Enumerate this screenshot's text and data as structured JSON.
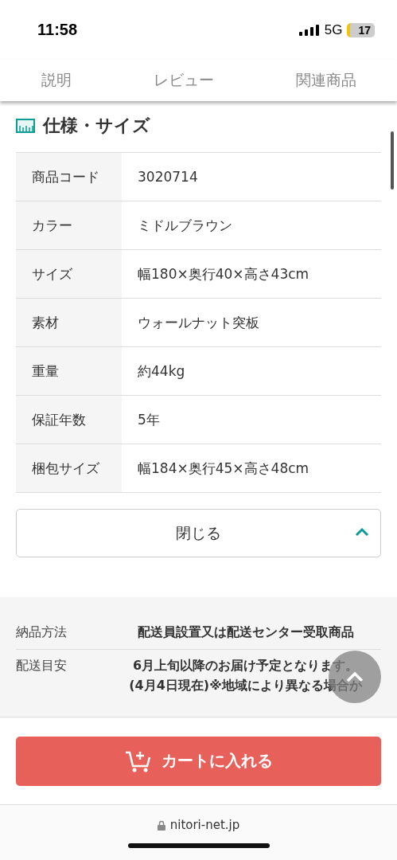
{
  "status_bar": {
    "time": "11:58",
    "network": "5G",
    "battery": "17"
  },
  "tabs": [
    {
      "label": "説明",
      "selected": false
    },
    {
      "label": "レビュー",
      "selected": false
    },
    {
      "label": "関連商品",
      "selected": false
    }
  ],
  "section_title": "仕様・サイズ",
  "specs": [
    {
      "label": "商品コード",
      "value": "3020714"
    },
    {
      "label": "カラー",
      "value": "ミドルブラウン"
    },
    {
      "label": "サイズ",
      "value": "幅180×奥行40×高さ43cm"
    },
    {
      "label": "素材",
      "value": "ウォールナット突板"
    },
    {
      "label": "重量",
      "value": "約44kg"
    },
    {
      "label": "保証年数",
      "value": "5年"
    },
    {
      "label": "梱包サイズ",
      "value": "幅184×奥行45×高さ48cm"
    }
  ],
  "close_button": "閉じる",
  "delivery": [
    {
      "label": "納品方法",
      "lines": [
        "配送員設置又は配送センター受取商品"
      ]
    },
    {
      "label": "配送目安",
      "lines": [
        "6月上旬以降のお届け予定となります。",
        "(4月4日現在)※地域により異なる場合が"
      ]
    }
  ],
  "cart_button": "カートに入れる",
  "url": "nitori-net.jp"
}
